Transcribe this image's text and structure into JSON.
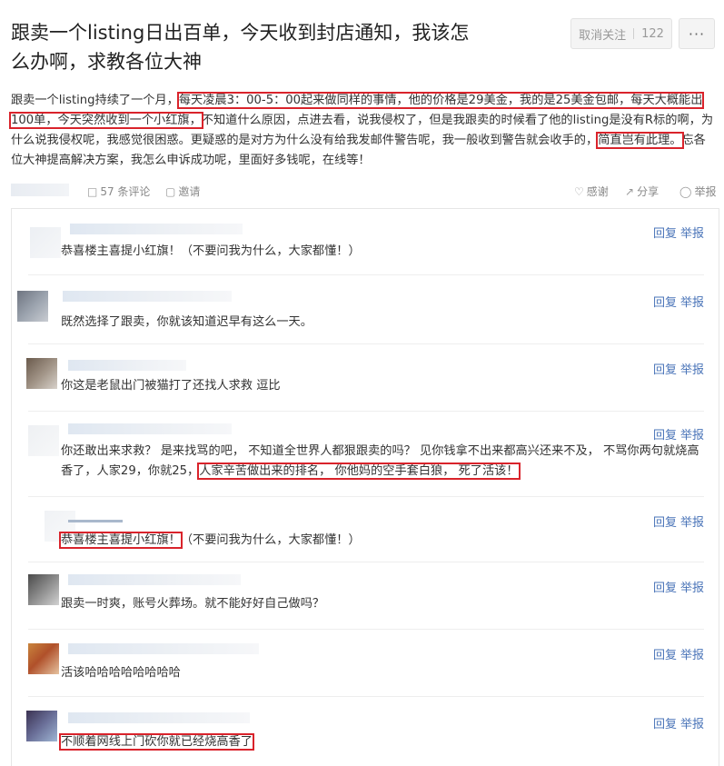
{
  "post": {
    "title": "跟卖一个listing日出百单，今天收到封店通知，我该怎么办啊，求教各位大神",
    "unfollow_label": "取消关注",
    "follow_count": "122",
    "more_label": "···",
    "body": {
      "p1": "跟卖一个listing持续了一个月，",
      "h1": "每天凌晨3：00-5：00起来做同样的事情，他的价格是29美金，我的是25美金包邮，每天大概能出100单，今天突然收到一个小红旗，",
      "p2": "不知道什么原因，点进去看，说我侵权了，但是我跟卖的时候看了他的listing是没有R标的啊，为什么说我侵权呢，我感觉很困惑。更疑惑的是对方为什么没有给我发邮件警告呢，我一般收到警告就会收手的，",
      "h2": "简直岂有此理。",
      "p3": "忘各位大神提高解决方案，我怎么申诉成功呢，里面好多钱呢，在线等！"
    }
  },
  "meta": {
    "comments": "57 条评论",
    "invite": "邀请",
    "thanks": "感谢",
    "share": "分享",
    "report": "举报"
  },
  "actions": {
    "reply": "回复",
    "report": "举报"
  },
  "comments": [
    {
      "text": "恭喜楼主喜提小红旗！（不要问我为什么，大家都懂！）"
    },
    {
      "text": "既然选择了跟卖，你就该知道迟早有这么一天。"
    },
    {
      "text": "你这是老鼠出门被猫打了还找人求救 逗比"
    },
    {
      "pre": "你还敢出来求救？ 是来找骂的吧， 不知道全世界人都狠跟卖的吗？ 见你钱拿不出来都高兴还来不及， 不骂你两句就烧高香了，人家29，你就25，",
      "hl": "人家辛苦做出来的排名， 你他妈的空手套白狼， 死了活该！"
    },
    {
      "hl": "恭喜楼主喜提小红旗！",
      "post": "（不要问我为什么，大家都懂！）"
    },
    {
      "text": "跟卖一时爽，账号火葬场。就不能好好自己做吗？"
    },
    {
      "text": "活该哈哈哈哈哈哈哈哈"
    },
    {
      "hl": "不顺着网线上门砍你就已经烧高香了"
    }
  ],
  "colors": {
    "link": "#4a74b8",
    "highlight": "#d9232b",
    "border": "#e6e6e6"
  }
}
